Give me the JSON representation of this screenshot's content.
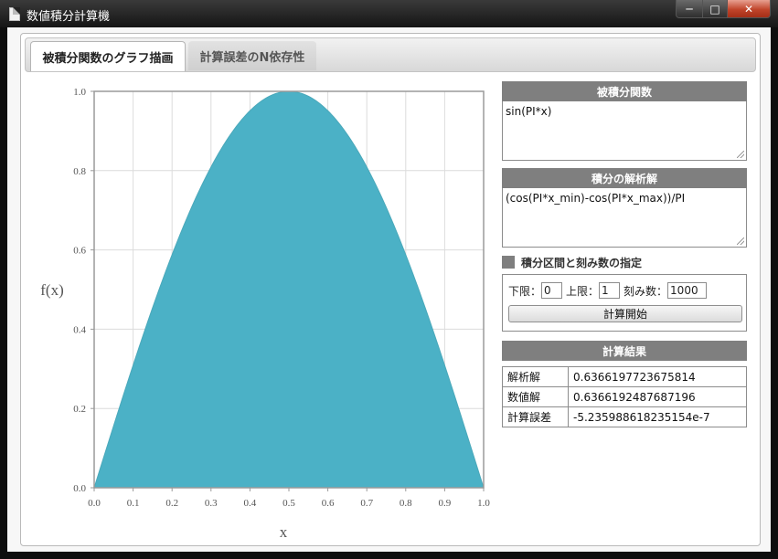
{
  "window": {
    "title": "数値積分計算機"
  },
  "tabs": [
    {
      "label": "被積分関数のグラフ描画",
      "active": true
    },
    {
      "label": "計算誤差のN依存性",
      "active": false
    }
  ],
  "chart_data": {
    "type": "area",
    "function": "sin(PI*x)",
    "x": [
      0.0,
      0.05,
      0.1,
      0.15,
      0.2,
      0.25,
      0.3,
      0.35,
      0.4,
      0.45,
      0.5,
      0.55,
      0.6,
      0.65,
      0.7,
      0.75,
      0.8,
      0.85,
      0.9,
      0.95,
      1.0
    ],
    "y": [
      0.0,
      0.156,
      0.309,
      0.454,
      0.588,
      0.707,
      0.809,
      0.891,
      0.951,
      0.988,
      1.0,
      0.988,
      0.951,
      0.891,
      0.809,
      0.707,
      0.588,
      0.454,
      0.309,
      0.156,
      0.0
    ],
    "xlabel": "x",
    "ylabel": "f(x)",
    "xlim": [
      0,
      1
    ],
    "ylim": [
      0,
      1
    ],
    "xticks": [
      "0.0",
      "0.1",
      "0.2",
      "0.3",
      "0.4",
      "0.5",
      "0.6",
      "0.7",
      "0.8",
      "0.9",
      "1.0"
    ],
    "yticks": [
      "0.0",
      "0.2",
      "0.4",
      "0.6",
      "0.8",
      "1.0"
    ],
    "grid": true,
    "fill_color": "#4bb1c6"
  },
  "integrand": {
    "label": "被積分関数",
    "value": "sin(PI*x)"
  },
  "analytic": {
    "label": "積分の解析解",
    "value": "(cos(PI*x_min)-cos(PI*x_max))/PI"
  },
  "range": {
    "label": "積分区間と刻み数の指定",
    "lower_label": "下限：",
    "lower": "0",
    "upper_label": "上限：",
    "upper": "1",
    "steps_label": "刻み数：",
    "steps": "1000",
    "button": "計算開始"
  },
  "results": {
    "label": "計算結果",
    "rows": [
      {
        "name": "解析解",
        "value": "0.6366197723675814"
      },
      {
        "name": "数値解",
        "value": "0.6366192487687196"
      },
      {
        "name": "計算誤差",
        "value": "-5.235988618235154e-7"
      }
    ]
  },
  "colors": {
    "accent": "#4bb1c6",
    "header": "#7f7f7f"
  }
}
